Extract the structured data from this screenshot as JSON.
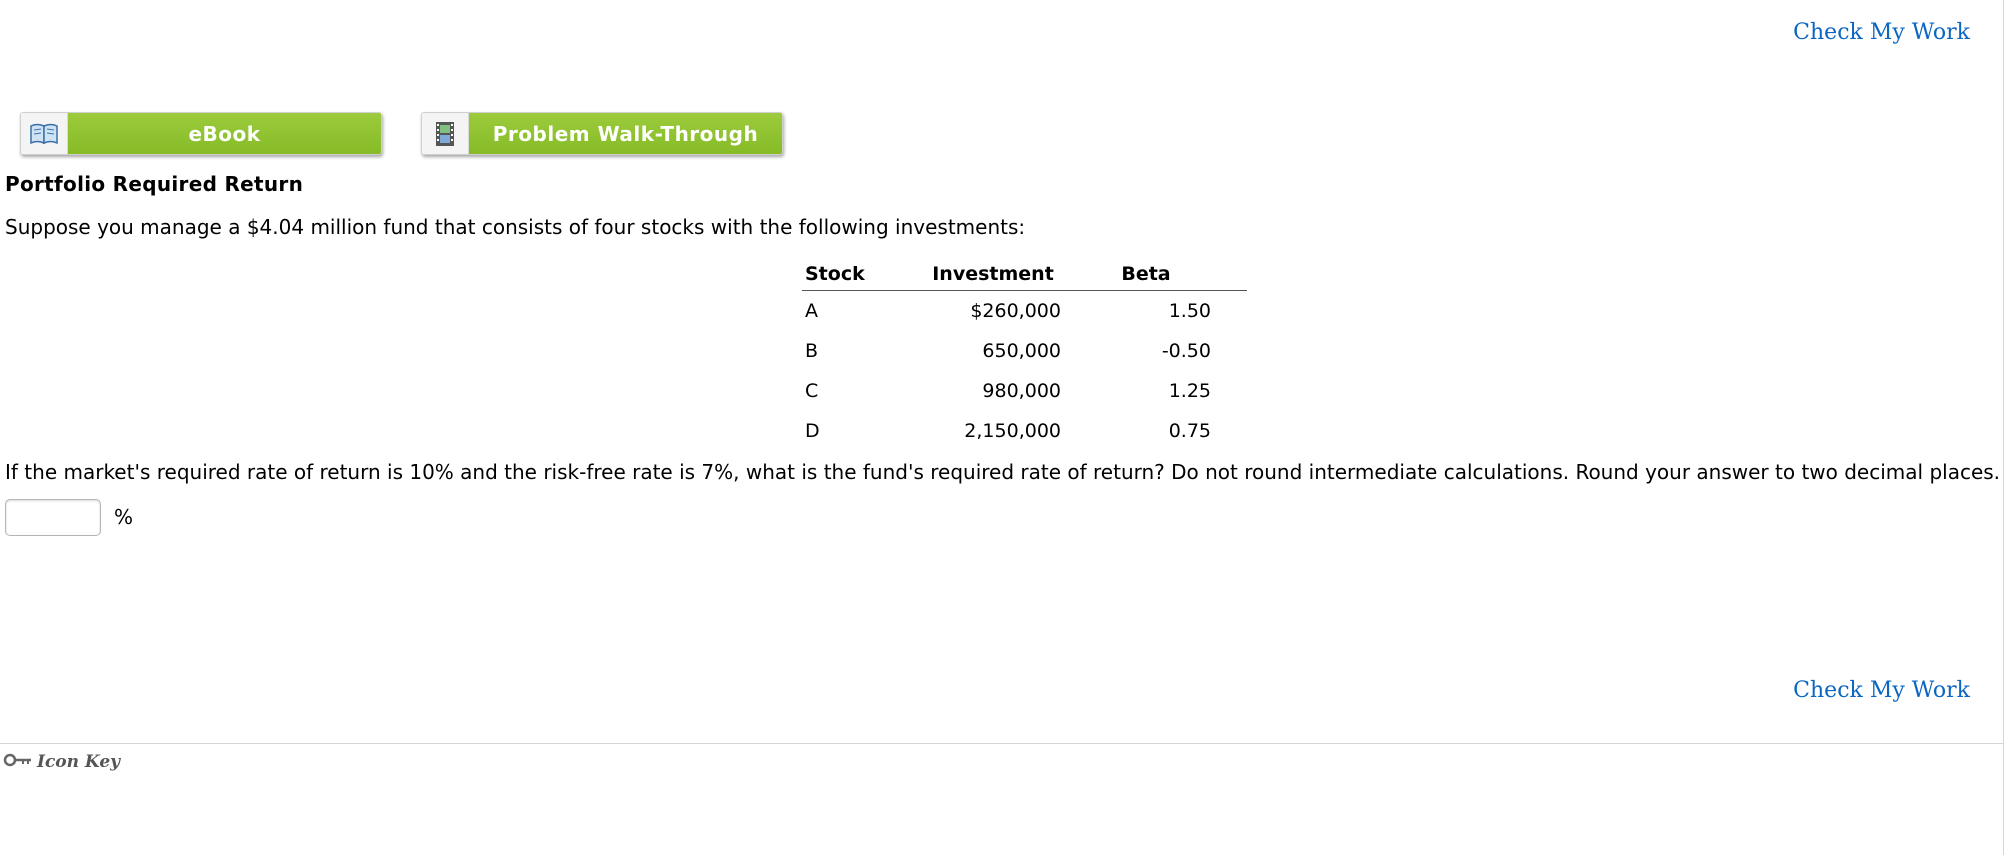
{
  "header": {
    "check_my_work": "Check My Work"
  },
  "resources": {
    "ebook_label": "eBook",
    "walkthrough_label": "Problem Walk-Through",
    "ebook_icon": "book-icon",
    "walkthrough_icon": "film-icon"
  },
  "problem": {
    "title": "Portfolio Required Return",
    "intro": "Suppose you manage a $4.04 million fund that consists of four stocks with the following investments:",
    "question": "If the market's required rate of return is 10% and the risk-free rate is 7%, what is the fund's required rate of return? Do not round intermediate calculations. Round your answer to two decimal places.",
    "answer_value": "",
    "unit": "%"
  },
  "table": {
    "headers": [
      "Stock",
      "Investment",
      "Beta"
    ],
    "rows": [
      [
        "A",
        "$260,000",
        "1.50"
      ],
      [
        "B",
        "650,000",
        "-0.50"
      ],
      [
        "C",
        "980,000",
        "1.25"
      ],
      [
        "D",
        "2,150,000",
        "0.75"
      ]
    ]
  },
  "footer": {
    "check_my_work": "Check My Work",
    "icon_key_label": "Icon Key",
    "icon_key_icon": "key-icon"
  },
  "colors": {
    "link": "#0a66c2",
    "button_green": "#8dc22e"
  }
}
